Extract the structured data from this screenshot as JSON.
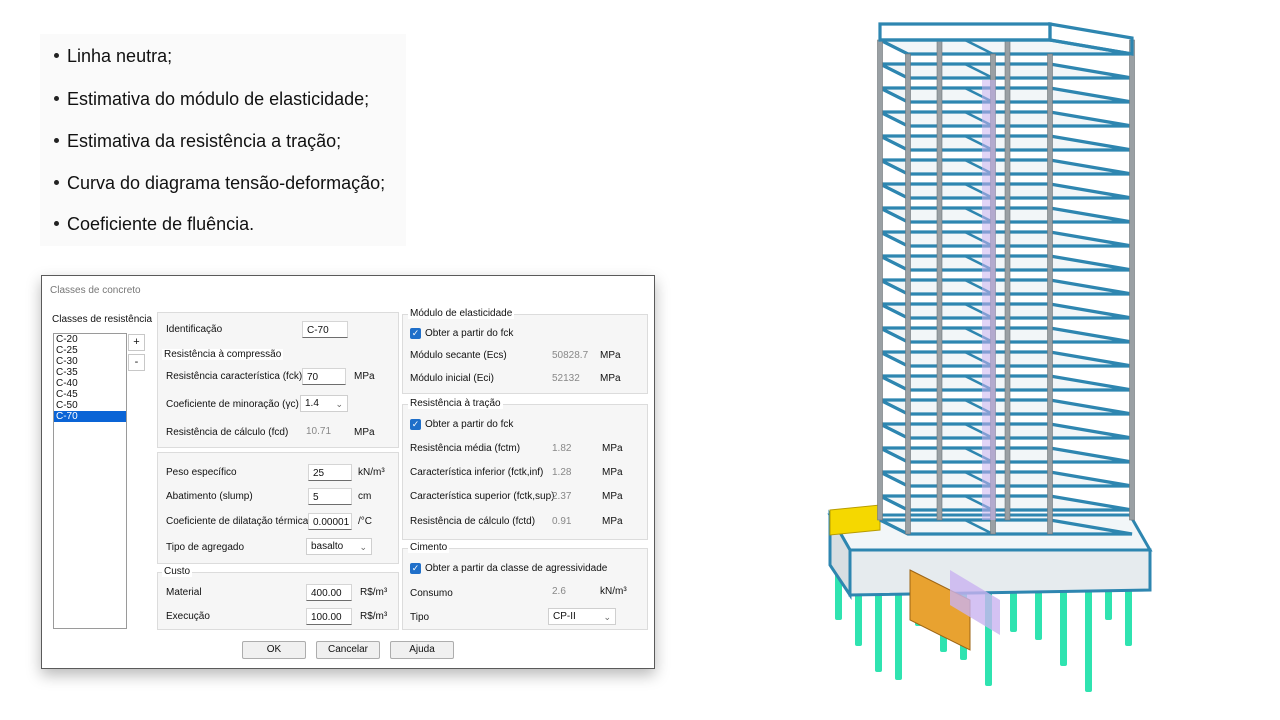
{
  "bullets": [
    "Linha neutra;",
    "Estimativa do módulo de elasticidade;",
    "Estimativa da resistência a tração;",
    "Curva do diagrama tensão-deformação;",
    "Coeficiente de fluência."
  ],
  "dialog": {
    "title": "Classes de concreto",
    "classes_label": "Classes de resistência",
    "classes": [
      "C-20",
      "C-25",
      "C-30",
      "C-35",
      "C-40",
      "C-45",
      "C-50",
      "C-70"
    ],
    "selected_class": "C-70",
    "add_label": "+",
    "remove_label": "-",
    "identificacao": {
      "label": "Identificação",
      "value": "C-70"
    },
    "compressao": {
      "title": "Resistência à compressão",
      "fck": {
        "label": "Resistência característica (fck)",
        "value": "70",
        "unit": "MPa"
      },
      "gamma": {
        "label": "Coeficiente de minoração (γc)",
        "value": "1.4"
      },
      "fcd": {
        "label": "Resistência de cálculo (fcd)",
        "value": "10.71",
        "unit": "MPa"
      }
    },
    "props": {
      "peso": {
        "label": "Peso específico",
        "value": "25",
        "unit": "kN/m³"
      },
      "slump": {
        "label": "Abatimento (slump)",
        "value": "5",
        "unit": "cm"
      },
      "dilat": {
        "label": "Coeficiente de dilatação térmica",
        "value": "0.00001",
        "unit": "/°C"
      },
      "agregado": {
        "label": "Tipo de agregado",
        "value": "basalto"
      }
    },
    "custo": {
      "title": "Custo",
      "material": {
        "label": "Material",
        "value": "400.00",
        "unit": "R$/m³"
      },
      "execucao": {
        "label": "Execução",
        "value": "100.00",
        "unit": "R$/m³"
      }
    },
    "modulo": {
      "title": "Módulo de elasticidade",
      "check": "Obter a partir do fck",
      "ecs": {
        "label": "Módulo secante (Ecs)",
        "value": "50828.7",
        "unit": "MPa"
      },
      "eci": {
        "label": "Módulo inicial (Eci)",
        "value": "52132",
        "unit": "MPa"
      }
    },
    "tracao": {
      "title": "Resistência à tração",
      "check": "Obter a partir do fck",
      "fctm": {
        "label": "Resistência média (fctm)",
        "value": "1.82",
        "unit": "MPa"
      },
      "inf": {
        "label": "Característica inferior (fctk,inf)",
        "value": "1.28",
        "unit": "MPa"
      },
      "sup": {
        "label": "Característica superior (fctk,sup)",
        "value": "2.37",
        "unit": "MPa"
      },
      "fctd": {
        "label": "Resistência de cálculo (fctd)",
        "value": "0.91",
        "unit": "MPa"
      }
    },
    "cimento": {
      "title": "Cimento",
      "check": "Obter a partir da classe de agressividade",
      "consumo": {
        "label": "Consumo",
        "value": "2.6",
        "unit": "kN/m³"
      },
      "tipo": {
        "label": "Tipo",
        "value": "CP-II"
      }
    },
    "buttons": {
      "ok": "OK",
      "cancel": "Cancelar",
      "help": "Ajuda"
    }
  },
  "colors": {
    "beam": "#2e86b0",
    "column": "#9aa0a4",
    "pile": "#2fe3b0",
    "slab": "#f2f6f8",
    "stair": "#c9b3f0",
    "accent_yellow": "#f5d800",
    "accent_orange": "#e8a230"
  }
}
